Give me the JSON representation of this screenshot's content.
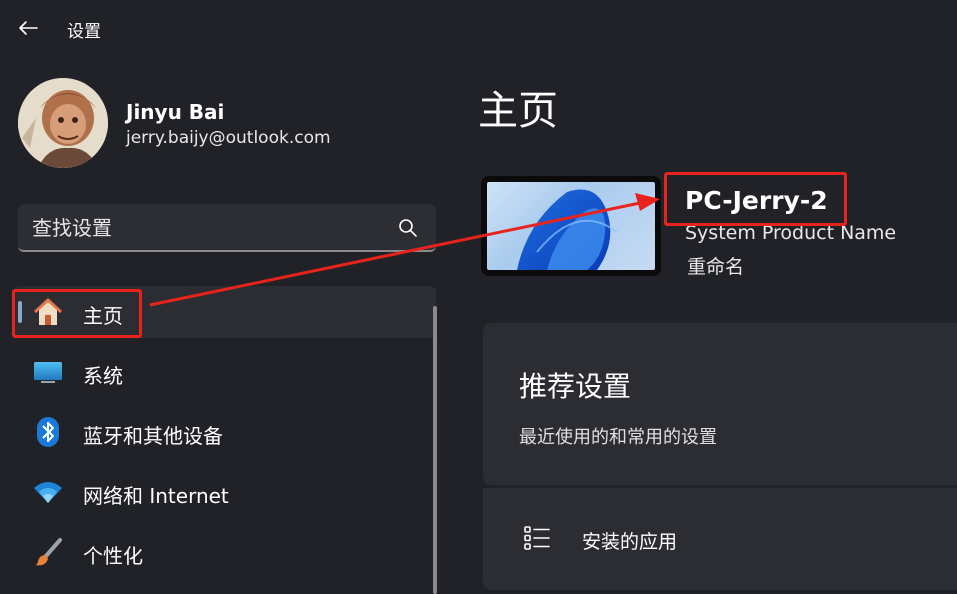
{
  "titlebar": {
    "app_title": "设置"
  },
  "profile": {
    "name": "Jinyu Bai",
    "email": "jerry.baijy@outlook.com"
  },
  "search": {
    "placeholder": "查找设置"
  },
  "nav": {
    "items": [
      {
        "label": "主页",
        "icon": "home-icon",
        "active": true
      },
      {
        "label": "系统",
        "icon": "monitor-icon",
        "active": false
      },
      {
        "label": "蓝牙和其他设备",
        "icon": "bluetooth-icon",
        "active": false
      },
      {
        "label": "网络和 Internet",
        "icon": "wifi-icon",
        "active": false
      },
      {
        "label": "个性化",
        "icon": "brush-icon",
        "active": false
      }
    ]
  },
  "main": {
    "page_title": "主页",
    "device": {
      "name": "PC-Jerry-2",
      "model": "System Product Name",
      "rename_label": "重命名"
    },
    "recommended": {
      "title": "推荐设置",
      "subtitle": "最近使用的和常用的设置",
      "items": [
        {
          "label": "安装的应用",
          "icon": "apps-list-icon"
        }
      ]
    }
  },
  "annotation": {
    "color": "#e8231c"
  },
  "colors": {
    "background": "#202227",
    "card": "#2b2d32",
    "accent": "#8ca8c8"
  }
}
